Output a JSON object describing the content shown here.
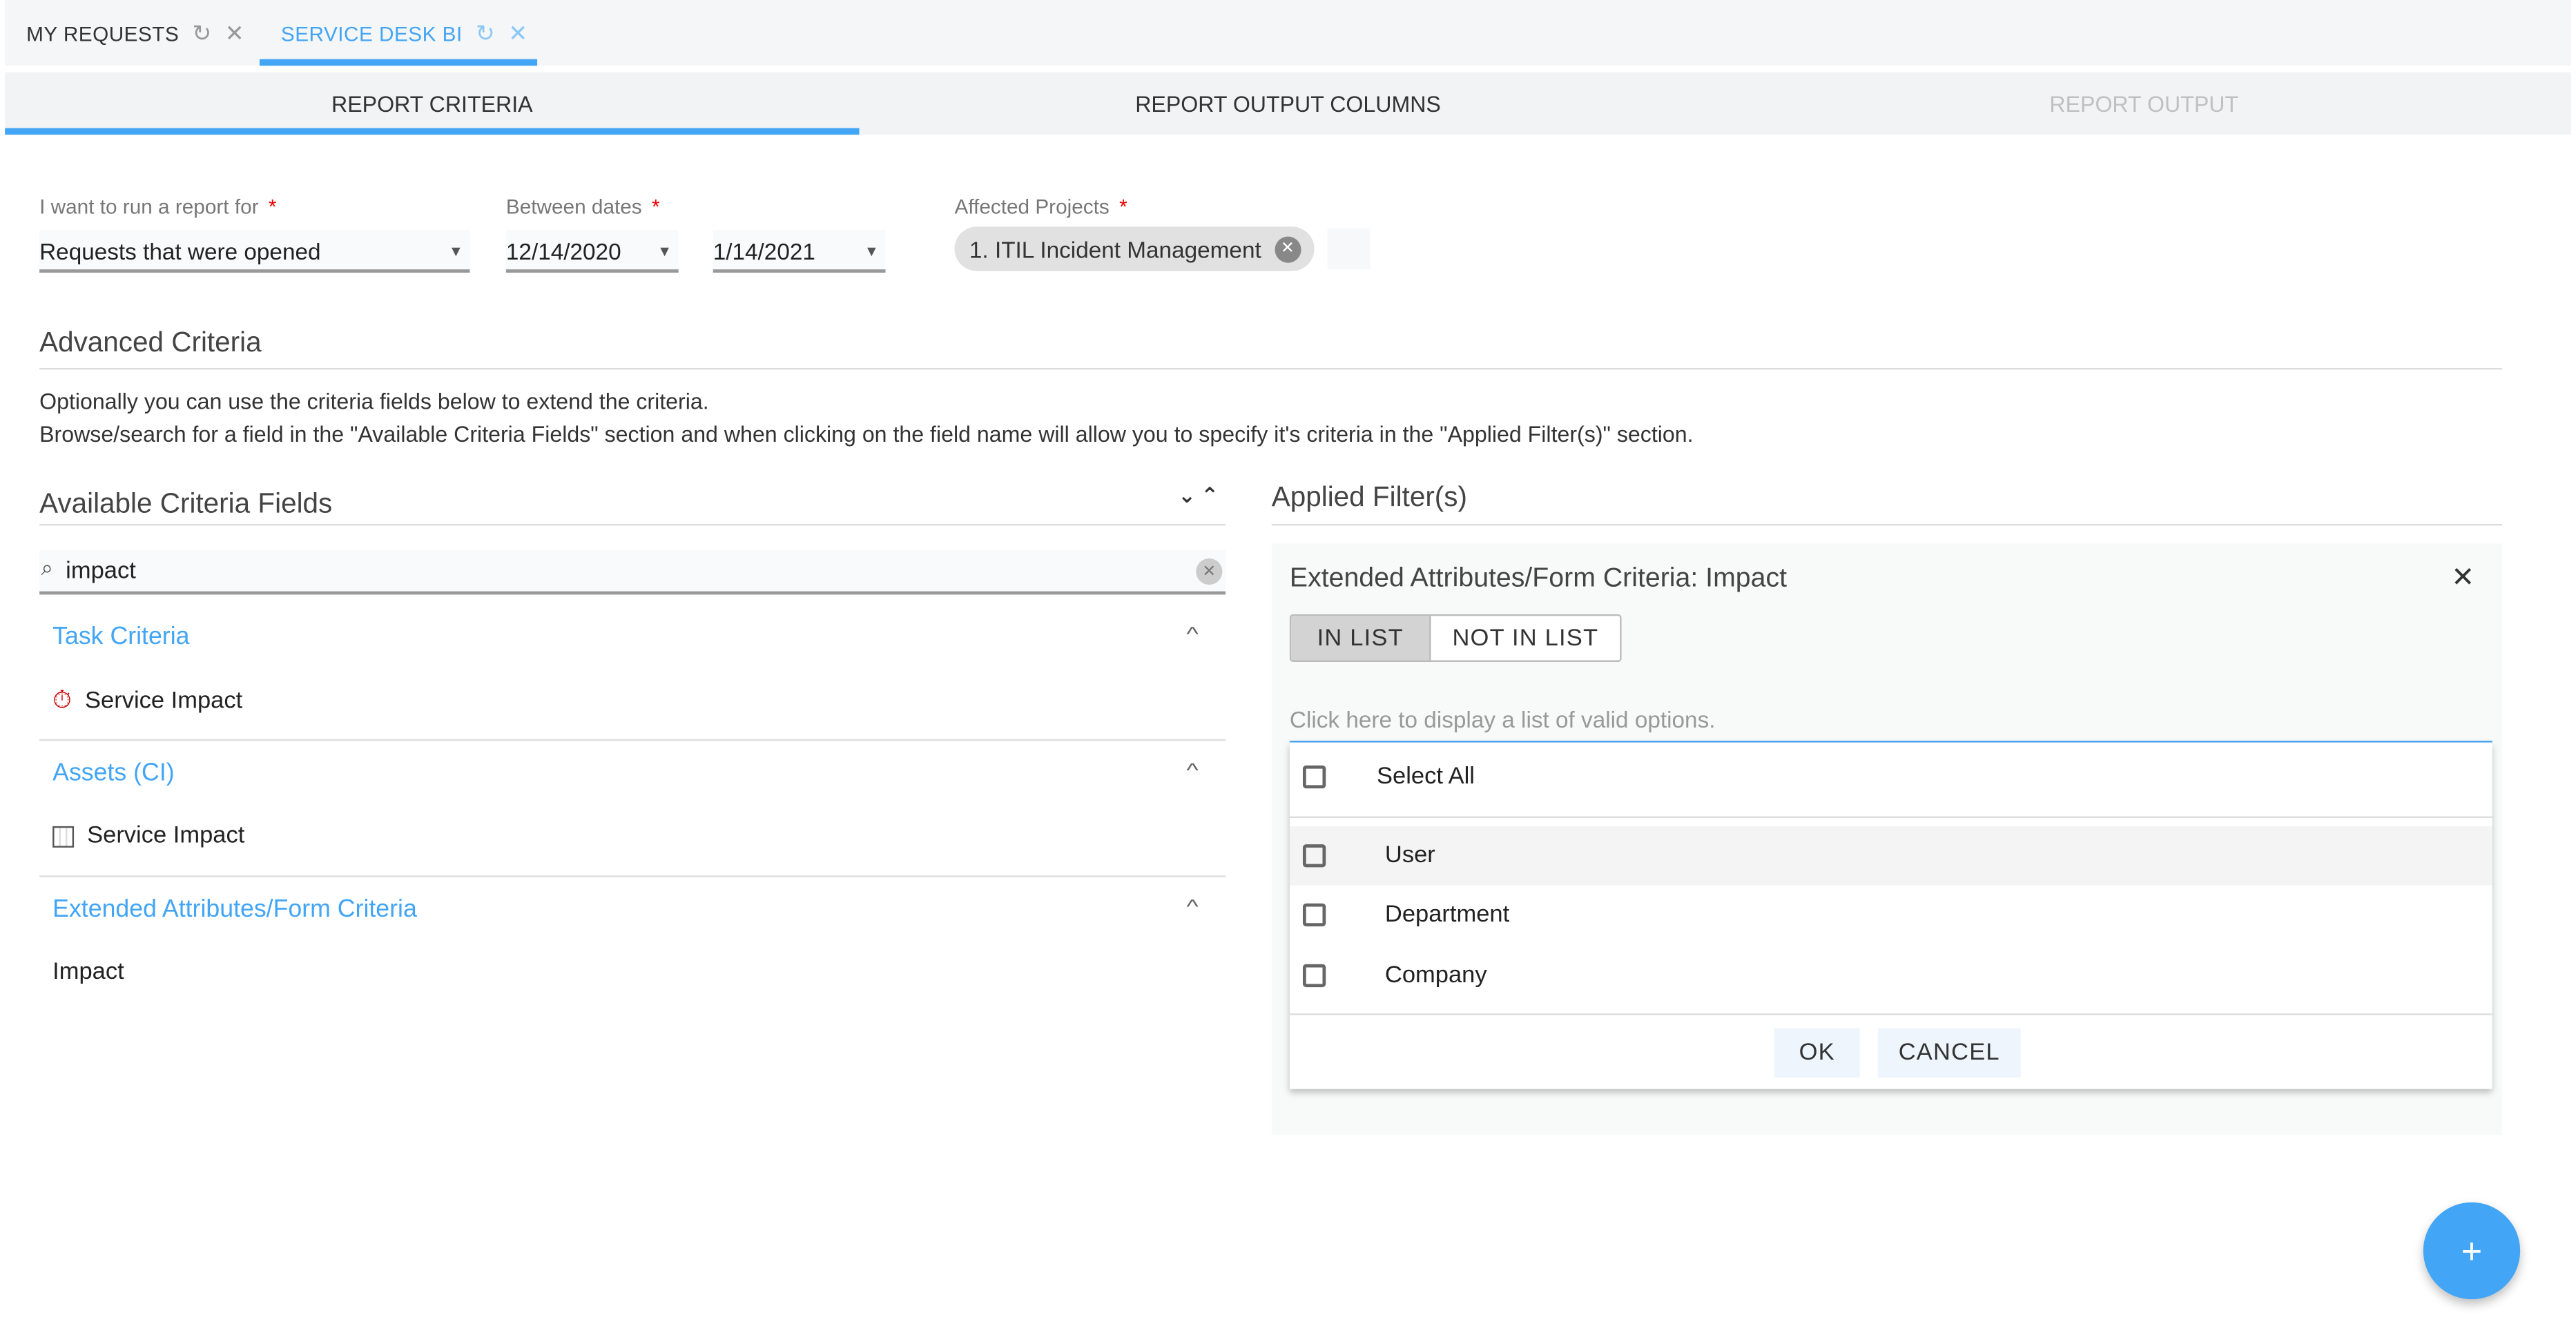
{
  "colors": {
    "accent": "#42a5f5",
    "required": "#ee0000"
  },
  "top_tabs": [
    {
      "label": "MY REQUESTS",
      "active": false,
      "icons": [
        "refresh-icon",
        "close-icon"
      ]
    },
    {
      "label": "SERVICE DESK BI",
      "active": true,
      "icons": [
        "refresh-icon",
        "close-icon"
      ]
    }
  ],
  "sub_tabs": [
    {
      "label": "REPORT CRITERIA",
      "state": "active"
    },
    {
      "label": "REPORT OUTPUT COLUMNS",
      "state": "enabled"
    },
    {
      "label": "REPORT OUTPUT",
      "state": "disabled"
    }
  ],
  "criteria": {
    "report_for_label": "I want to run a report for",
    "report_for_value": "Requests that were opened",
    "dates_label": "Between dates",
    "date_from": "12/14/2020",
    "date_to": "1/14/2021",
    "projects_label": "Affected Projects",
    "projects_chip": "1. ITIL Incident Management",
    "required_mark": "*"
  },
  "advanced": {
    "title": "Advanced Criteria",
    "desc1": "Optionally you can use the criteria fields below to extend the criteria.",
    "desc2": "Browse/search for a field in the \"Available Criteria Fields\" section and when clicking on the field name will allow you to specify it's criteria in the \"Applied Filter(s)\" section."
  },
  "available": {
    "title": "Available Criteria Fields",
    "search_value": "impact",
    "groups": [
      {
        "label": "Task Criteria",
        "items": [
          {
            "label": "Service Impact",
            "icon": "stopwatch-icon"
          }
        ]
      },
      {
        "label": "Assets (CI)",
        "items": [
          {
            "label": "Service Impact",
            "icon": "asset-grid-icon"
          }
        ]
      },
      {
        "label": "Extended Attributes/Form Criteria",
        "items": [
          {
            "label": "Impact"
          }
        ]
      }
    ]
  },
  "applied": {
    "title": "Applied Filter(s)",
    "filter_title": "Extended Attributes/Form Criteria: Impact",
    "toggle": [
      {
        "label": "IN LIST",
        "selected": true
      },
      {
        "label": "NOT IN LIST",
        "selected": false
      }
    ],
    "input_placeholder": "Click here to display a list of valid options.",
    "select_all": "Select All",
    "options": [
      {
        "label": "User",
        "checked": false
      },
      {
        "label": "Department",
        "checked": false
      },
      {
        "label": "Company",
        "checked": false
      }
    ],
    "ok": "OK",
    "cancel": "CANCEL"
  },
  "fab": "+"
}
